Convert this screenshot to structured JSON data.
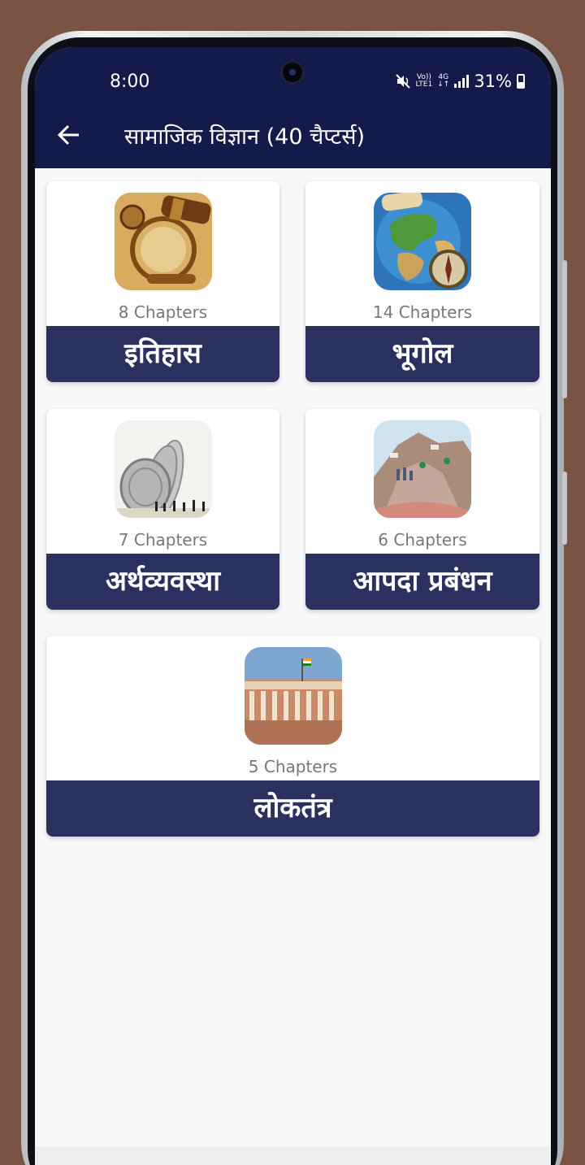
{
  "status_bar": {
    "time": "8:00",
    "network_top": "Vo))",
    "network_bottom": "LTE1",
    "net_type_top": "4G",
    "net_type_bottom": "↓↑",
    "battery": "31%"
  },
  "app_bar": {
    "title": "सामाजिक विज्ञान (40 चैप्टर्स)"
  },
  "subjects": [
    {
      "name": "इतिहास",
      "chapters": "8 Chapters",
      "icon": "history-compass-icon"
    },
    {
      "name": "भूगोल",
      "chapters": "14 Chapters",
      "icon": "globe-map-icon"
    },
    {
      "name": "अर्थव्यवस्था",
      "chapters": "7 Chapters",
      "icon": "coins-icon"
    },
    {
      "name": "आपदा प्रबंधन",
      "chapters": "6 Chapters",
      "icon": "disaster-crowd-icon"
    },
    {
      "name": "लोकतंत्र",
      "chapters": "5 Chapters",
      "icon": "parliament-icon"
    }
  ],
  "colors": {
    "header": "#141a4a",
    "label_bar": "#2b315f",
    "background": "#f8f8f8"
  }
}
